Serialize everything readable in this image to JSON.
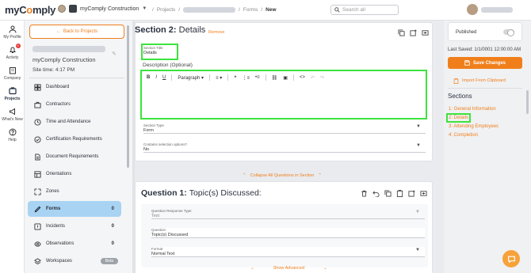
{
  "app": {
    "logo_text": "myC",
    "logo_accent": "o",
    "logo_rest": "mply"
  },
  "header": {
    "org_name": "myComply Construction",
    "breadcrumb_projects": "Projects",
    "breadcrumb_forms": "Forms",
    "breadcrumb_current": "New",
    "sep": "/",
    "search_placeholder": "Search all"
  },
  "rail": [
    {
      "label": "My Profile",
      "icon": "person-icon"
    },
    {
      "label": "Activity",
      "icon": "bell-icon",
      "badge": "9"
    },
    {
      "label": "Company",
      "icon": "building-icon"
    },
    {
      "label": "Projects",
      "icon": "projects-icon"
    },
    {
      "label": "What's New",
      "icon": "megaphone-icon"
    },
    {
      "label": "Help",
      "icon": "help-icon"
    }
  ],
  "panel": {
    "back_label": "Back to Projects",
    "project_name": "myComply Construction",
    "site_time": "Site time: 4:17 PM",
    "nav": [
      {
        "label": "Dashboard",
        "icon": "dashboard-icon",
        "count": ""
      },
      {
        "label": "Contractors",
        "icon": "briefcase-icon",
        "count": ""
      },
      {
        "label": "Time and Attendance",
        "icon": "clock-icon",
        "count": ""
      },
      {
        "label": "Certification Requirements",
        "icon": "check-circle-icon",
        "count": ""
      },
      {
        "label": "Document Requirements",
        "icon": "document-icon",
        "count": ""
      },
      {
        "label": "Orientations",
        "icon": "orientation-icon",
        "count": ""
      },
      {
        "label": "Zones",
        "icon": "zones-icon",
        "count": ""
      },
      {
        "label": "Forms",
        "icon": "pencil-icon",
        "count": "0"
      },
      {
        "label": "Incidents",
        "icon": "incident-icon",
        "count": "0"
      },
      {
        "label": "Observations",
        "icon": "eye-icon",
        "count": "0"
      },
      {
        "label": "Workspaces",
        "icon": "layers-icon",
        "count": "Beta"
      }
    ]
  },
  "section": {
    "heading_bold": "Section 2:",
    "heading_text": "Details",
    "remove_label": "Remove",
    "title_label": "Section Title",
    "title_value": "Details",
    "description_label": "Description (Optional)",
    "toolbar_paragraph": "Paragraph",
    "type_label": "Section Type",
    "type_value": "Form",
    "contains_label": "Contains selection options?",
    "contains_value": "No",
    "collapse_label": "Collapse All Questions in Section"
  },
  "question": {
    "heading_bold": "Question 1:",
    "heading_text": "Topic(s) Discussed:",
    "response_type_label": "Question Response Type",
    "response_type_value": "Text",
    "question_label": "Question",
    "question_value": "Topic(s) Discussed",
    "format_label": "Format",
    "format_value": "Normal Text",
    "show_advanced": "Show Advanced"
  },
  "right": {
    "published_label": "Published",
    "last_saved": "Last Saved: 1/1/0001 12:00:00 AM",
    "save_label": "Save Changes",
    "import_label": "Import From Clipboard",
    "sections_heading": "Sections",
    "sections": [
      "1: General Information",
      "2: Details",
      "3: Attending Employees",
      "4: Completion"
    ]
  },
  "colors": {
    "accent": "#f07f1b",
    "highlight": "#3de33d",
    "active_nav": "#a9d3f3"
  }
}
